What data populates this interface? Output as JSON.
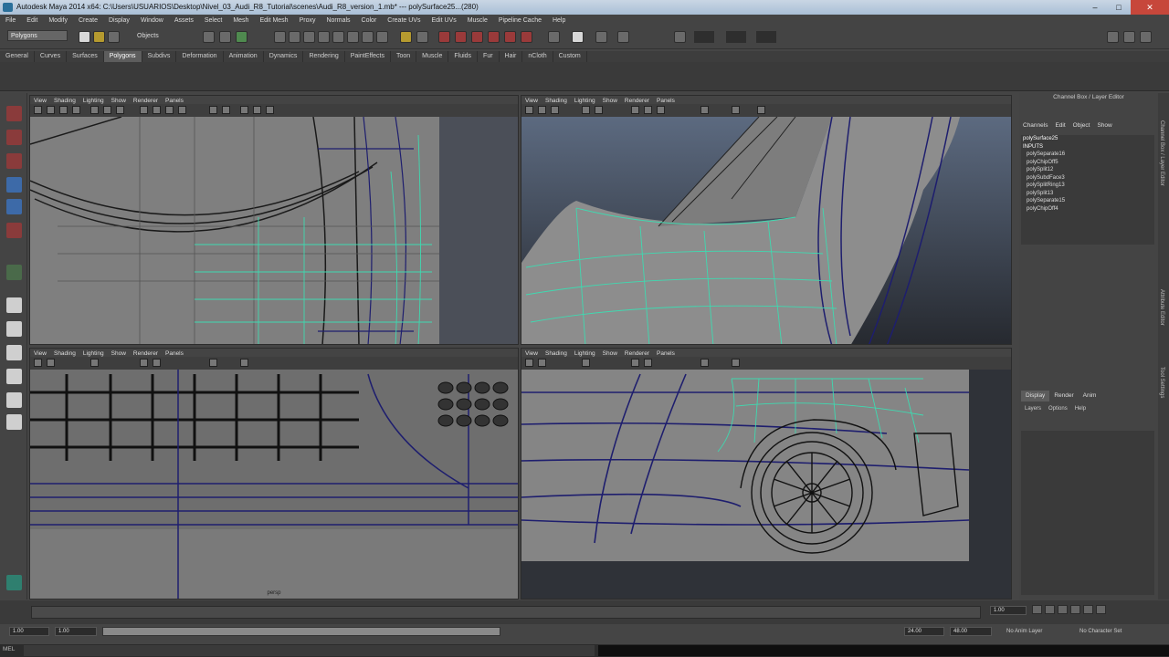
{
  "window": {
    "title": "Autodesk Maya 2014 x64: C:\\Users\\USUARIOS\\Desktop\\Nivel_03_Audi_R8_Tutorial\\scenes\\Audi_R8_version_1.mb* --- polySurface25...(280)",
    "minimize": "–",
    "maximize": "□",
    "close": "✕"
  },
  "menubar": [
    "File",
    "Edit",
    "Modify",
    "Create",
    "Display",
    "Window",
    "Assets",
    "Select",
    "Mesh",
    "Edit Mesh",
    "Proxy",
    "Normals",
    "Color",
    "Create UVs",
    "Edit UVs",
    "Muscle",
    "Pipeline Cache",
    "Help"
  ],
  "status": {
    "mode": "Polygons",
    "objects_label": "Objects"
  },
  "shelf_tabs": [
    "General",
    "Curves",
    "Surfaces",
    "Polygons",
    "Subdivs",
    "Deformation",
    "Animation",
    "Dynamics",
    "Rendering",
    "PaintEffects",
    "Toon",
    "Muscle",
    "Fluids",
    "Fur",
    "Hair",
    "nCloth",
    "Custom"
  ],
  "shelf_active": "Polygons",
  "panel_menu": [
    "View",
    "Shading",
    "Lighting",
    "Show",
    "Renderer",
    "Panels"
  ],
  "viewports": [
    {
      "name": "top-left",
      "label": ""
    },
    {
      "name": "top-right",
      "label": ""
    },
    {
      "name": "bottom-left",
      "label": "persp"
    },
    {
      "name": "bottom-right",
      "label": ""
    }
  ],
  "channel_box": {
    "title": "Channel Box / Layer Editor",
    "tabs": [
      "Channels",
      "Edit",
      "Object",
      "Show"
    ],
    "object": "polySurface25",
    "inputs_label": "INPUTS",
    "history": [
      "polySeparate16",
      "polyChipOff5",
      "polySplit12",
      "polySubdFace3",
      "polySplitRing13",
      "polySplit13",
      "polySeparate15",
      "polyChipOff4"
    ]
  },
  "layer_editor": {
    "tabs": [
      "Display",
      "Render",
      "Anim"
    ],
    "active": "Display",
    "menu": [
      "Layers",
      "Options",
      "Help"
    ]
  },
  "side_tabs": [
    "Channel Box / Layer Editor",
    "Attribute Editor",
    "Tool Settings"
  ],
  "time": {
    "current": "1.00",
    "range_start": "1.00",
    "anim_start": "1.00",
    "range_end": "24.00",
    "anim_end": "48.00",
    "playback_start": "1.00",
    "anim_layer": "No Anim Layer",
    "character_set": "No Character Set"
  },
  "command_line": {
    "label": "MEL"
  },
  "colors": {
    "wire": "#1e1e6e",
    "select": "#3fd9b0",
    "bg": "#454545"
  }
}
